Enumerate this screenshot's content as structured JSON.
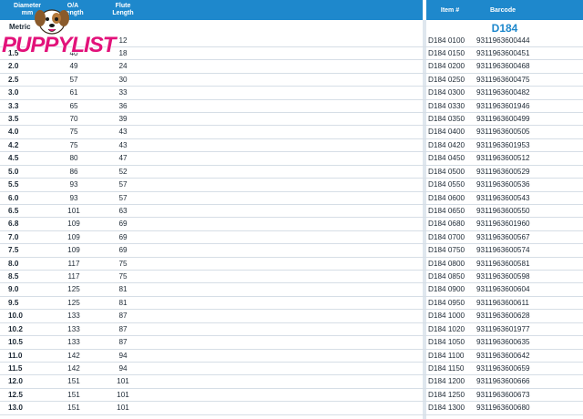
{
  "header": {
    "col_diameter": "Diameter\nmm",
    "col_oa": "O/A\nLength",
    "col_flute": "Flute\nLength",
    "col_item": "Item #",
    "col_barcode": "Barcode"
  },
  "section_label": "Metric",
  "product_code": "D184",
  "logo": {
    "text1": "PUPPY",
    "text2": "LIST",
    "color_pink": "#e2127a"
  },
  "colors": {
    "header_bg": "#1e88cc",
    "accent": "#1e88cc"
  },
  "rows": [
    {
      "dia": "",
      "oa": "",
      "fl": "12",
      "item": "D184 0100",
      "barcode": "9311963600444"
    },
    {
      "dia": "1.5",
      "oa": "40",
      "fl": "18",
      "item": "D184 0150",
      "barcode": "9311963600451"
    },
    {
      "dia": "2.0",
      "oa": "49",
      "fl": "24",
      "item": "D184 0200",
      "barcode": "9311963600468"
    },
    {
      "dia": "2.5",
      "oa": "57",
      "fl": "30",
      "item": "D184 0250",
      "barcode": "9311963600475"
    },
    {
      "dia": "3.0",
      "oa": "61",
      "fl": "33",
      "item": "D184 0300",
      "barcode": "9311963600482"
    },
    {
      "dia": "3.3",
      "oa": "65",
      "fl": "36",
      "item": "D184 0330",
      "barcode": "9311963601946"
    },
    {
      "dia": "3.5",
      "oa": "70",
      "fl": "39",
      "item": "D184 0350",
      "barcode": "9311963600499"
    },
    {
      "dia": "4.0",
      "oa": "75",
      "fl": "43",
      "item": "D184 0400",
      "barcode": "9311963600505"
    },
    {
      "dia": "4.2",
      "oa": "75",
      "fl": "43",
      "item": "D184 0420",
      "barcode": "9311963601953"
    },
    {
      "dia": "4.5",
      "oa": "80",
      "fl": "47",
      "item": "D184 0450",
      "barcode": "9311963600512"
    },
    {
      "dia": "5.0",
      "oa": "86",
      "fl": "52",
      "item": "D184 0500",
      "barcode": "9311963600529"
    },
    {
      "dia": "5.5",
      "oa": "93",
      "fl": "57",
      "item": "D184 0550",
      "barcode": "9311963600536"
    },
    {
      "dia": "6.0",
      "oa": "93",
      "fl": "57",
      "item": "D184 0600",
      "barcode": "9311963600543"
    },
    {
      "dia": "6.5",
      "oa": "101",
      "fl": "63",
      "item": "D184 0650",
      "barcode": "9311963600550"
    },
    {
      "dia": "6.8",
      "oa": "109",
      "fl": "69",
      "item": "D184 0680",
      "barcode": "9311963601960"
    },
    {
      "dia": "7.0",
      "oa": "109",
      "fl": "69",
      "item": "D184 0700",
      "barcode": "9311963600567"
    },
    {
      "dia": "7.5",
      "oa": "109",
      "fl": "69",
      "item": "D184 0750",
      "barcode": "9311963600574"
    },
    {
      "dia": "8.0",
      "oa": "117",
      "fl": "75",
      "item": "D184 0800",
      "barcode": "9311963600581"
    },
    {
      "dia": "8.5",
      "oa": "117",
      "fl": "75",
      "item": "D184 0850",
      "barcode": "9311963600598"
    },
    {
      "dia": "9.0",
      "oa": "125",
      "fl": "81",
      "item": "D184 0900",
      "barcode": "9311963600604"
    },
    {
      "dia": "9.5",
      "oa": "125",
      "fl": "81",
      "item": "D184 0950",
      "barcode": "9311963600611"
    },
    {
      "dia": "10.0",
      "oa": "133",
      "fl": "87",
      "item": "D184 1000",
      "barcode": "9311963600628"
    },
    {
      "dia": "10.2",
      "oa": "133",
      "fl": "87",
      "item": "D184 1020",
      "barcode": "9311963601977"
    },
    {
      "dia": "10.5",
      "oa": "133",
      "fl": "87",
      "item": "D184 1050",
      "barcode": "9311963600635"
    },
    {
      "dia": "11.0",
      "oa": "142",
      "fl": "94",
      "item": "D184 1100",
      "barcode": "9311963600642"
    },
    {
      "dia": "11.5",
      "oa": "142",
      "fl": "94",
      "item": "D184 1150",
      "barcode": "9311963600659"
    },
    {
      "dia": "12.0",
      "oa": "151",
      "fl": "101",
      "item": "D184 1200",
      "barcode": "9311963600666"
    },
    {
      "dia": "12.5",
      "oa": "151",
      "fl": "101",
      "item": "D184 1250",
      "barcode": "9311963600673"
    },
    {
      "dia": "13.0",
      "oa": "151",
      "fl": "101",
      "item": "D184 1300",
      "barcode": "9311963600680"
    }
  ]
}
